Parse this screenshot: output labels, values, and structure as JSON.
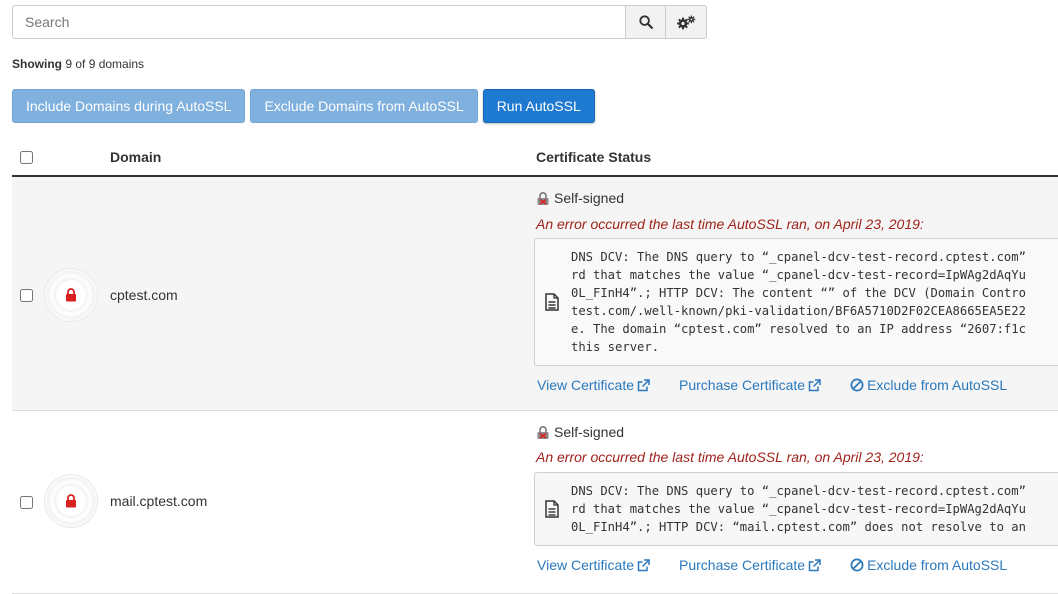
{
  "search": {
    "placeholder": "Search"
  },
  "showing": {
    "label": "Showing",
    "text": "9 of 9 domains"
  },
  "actions": {
    "include_label": "Include Domains during AutoSSL",
    "exclude_label": "Exclude Domains from AutoSSL",
    "run_label": "Run AutoSSL"
  },
  "table": {
    "headers": {
      "domain": "Domain",
      "status": "Certificate Status"
    },
    "rows": [
      {
        "domain": "cptest.com",
        "status": "Self-signed",
        "error_heading": "An error occurred the last time AutoSSL ran, on April 23, 2019:",
        "error_text": "DNS DCV: The DNS query to “_cpanel-dcv-test-record.cptest.com” \nrd that matches the value “_cpanel-dcv-test-record=IpWAg2dAqYu\n0L_FInH4”.; HTTP DCV: The content “” of the DCV (Domain Contro\ntest.com/.well-known/pki-validation/BF6A5710D2F02CEA8665EA5E22\ne. The domain “cptest.com” resolved to an IP address “2607:f1c\nthis server.",
        "view_label": "View Certificate",
        "purchase_label": "Purchase Certificate",
        "exclude_label": "Exclude from AutoSSL"
      },
      {
        "domain": "mail.cptest.com",
        "status": "Self-signed",
        "error_heading": "An error occurred the last time AutoSSL ran, on April 23, 2019:",
        "error_text": "DNS DCV: The DNS query to “_cpanel-dcv-test-record.cptest.com” \nrd that matches the value “_cpanel-dcv-test-record=IpWAg2dAqYu\n0L_FInH4”.; HTTP DCV: “mail.cptest.com” does not resolve to an",
        "view_label": "View Certificate",
        "purchase_label": "Purchase Certificate",
        "exclude_label": "Exclude from AutoSSL"
      }
    ]
  },
  "colors": {
    "link": "#2a78bd",
    "error": "#a0231c",
    "primary": "#1e7ad0",
    "light_button": "#7fb0de",
    "lock": "#d9201f"
  }
}
